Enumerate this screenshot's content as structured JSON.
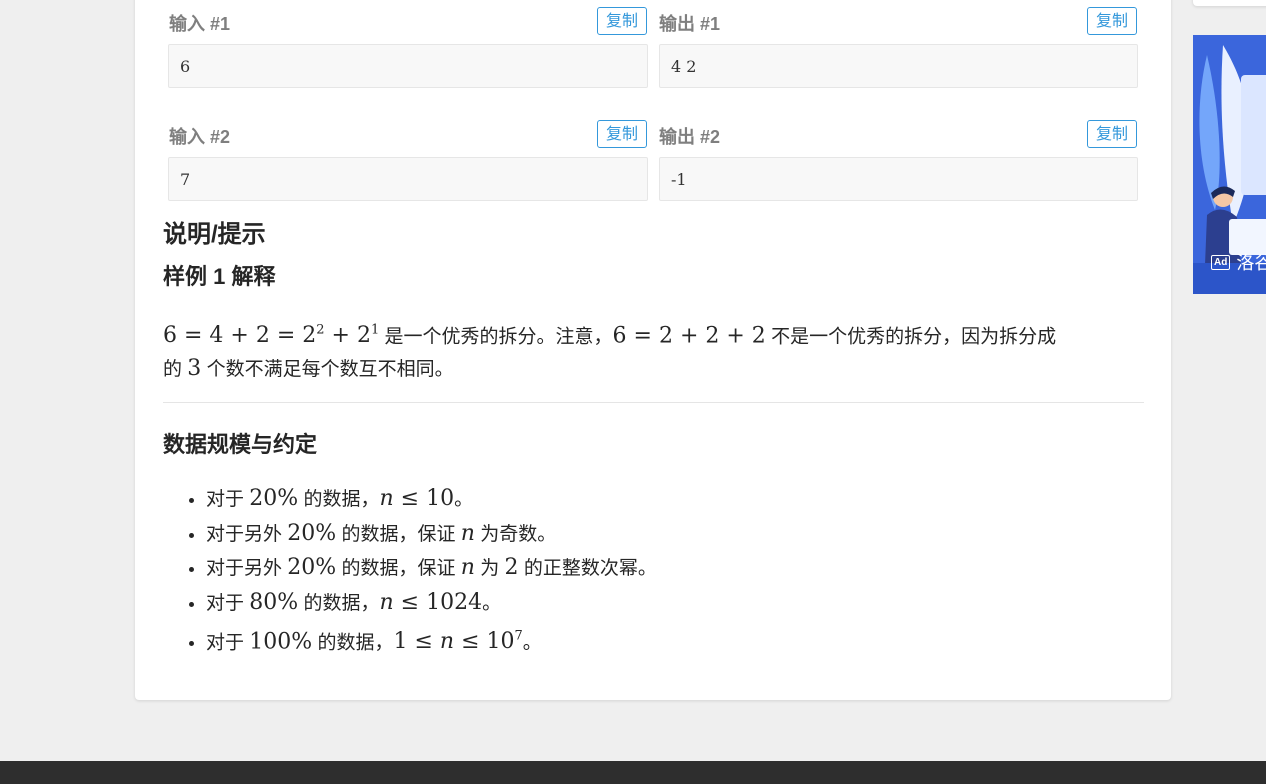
{
  "samples": [
    {
      "input_label": "输入 #1",
      "output_label": "输出 #1",
      "input": "6",
      "output": "4 2",
      "copy": "复制"
    },
    {
      "input_label": "输入 #2",
      "output_label": "输出 #2",
      "input": "7",
      "output": "-1",
      "copy": "复制"
    }
  ],
  "hint": {
    "title": "说明/提示",
    "sample_title": "样例 1 解释",
    "explain_text1": "是一个优秀的拆分。注意，",
    "explain_text2": "不是一个优秀的拆分，因为拆分成",
    "explain_text3a": "的",
    "explain_text3b": "个数不满足每个数互不相同。",
    "explain_num3": "3"
  },
  "constraints": {
    "title": "数据规模与约定",
    "items": [
      {
        "pre": "对于",
        "pct": "20%",
        "mid": "的数据，",
        "tail": "n ≤ 10",
        "end": "。"
      },
      {
        "pre": "对于另外",
        "pct": "20%",
        "mid": "的数据，保证",
        "tail": "n",
        "end": "为奇数。"
      },
      {
        "pre": "对于另外",
        "pct": "20%",
        "mid": "的数据，保证",
        "tail": "n",
        "end": "为",
        "num": "2",
        "end2": "的正整数次幂。"
      },
      {
        "pre": "对于",
        "pct": "80%",
        "mid": "的数据，",
        "tail": "n ≤ 1024",
        "end": "。"
      },
      {
        "pre": "对于",
        "pct": "100%",
        "mid": "的数据，",
        "tail": "1 ≤ n ≤ 10",
        "sup": "7",
        "end": "。"
      }
    ]
  },
  "ad": {
    "badge": "Ad",
    "text": "洛谷"
  }
}
